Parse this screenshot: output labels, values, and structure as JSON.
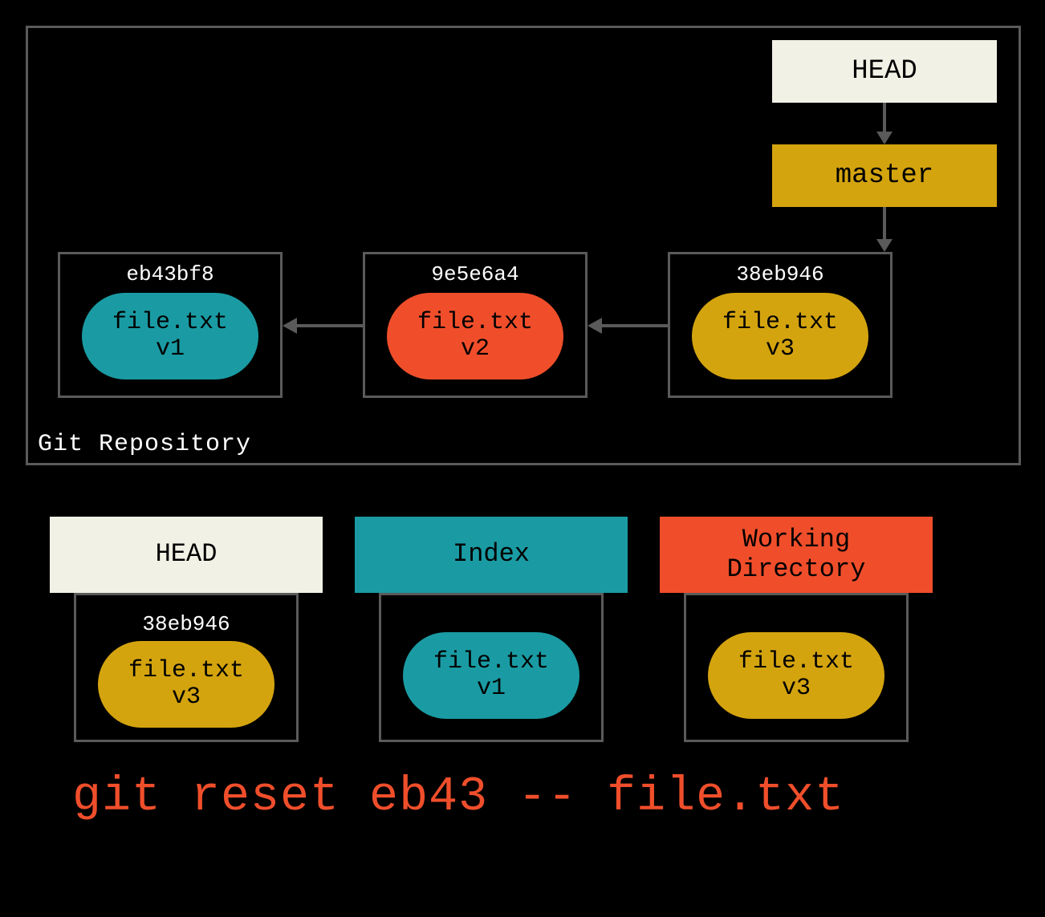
{
  "repo": {
    "label": "Git Repository",
    "head_label": "HEAD",
    "master_label": "master",
    "commits": [
      {
        "hash": "eb43bf8",
        "file": "file.txt",
        "version": "v1",
        "color": "teal"
      },
      {
        "hash": "9e5e6a4",
        "file": "file.txt",
        "version": "v2",
        "color": "orange"
      },
      {
        "hash": "38eb946",
        "file": "file.txt",
        "version": "v3",
        "color": "gold"
      }
    ]
  },
  "trees": {
    "head": {
      "title": "HEAD",
      "hash": "38eb946",
      "file": "file.txt",
      "version": "v3",
      "color": "gold"
    },
    "index": {
      "title": "Index",
      "hash": "",
      "file": "file.txt",
      "version": "v1",
      "color": "teal"
    },
    "wd": {
      "title": "Working\nDirectory",
      "hash": "",
      "file": "file.txt",
      "version": "v3",
      "color": "gold"
    }
  },
  "command": "git reset eb43 -- file.txt"
}
